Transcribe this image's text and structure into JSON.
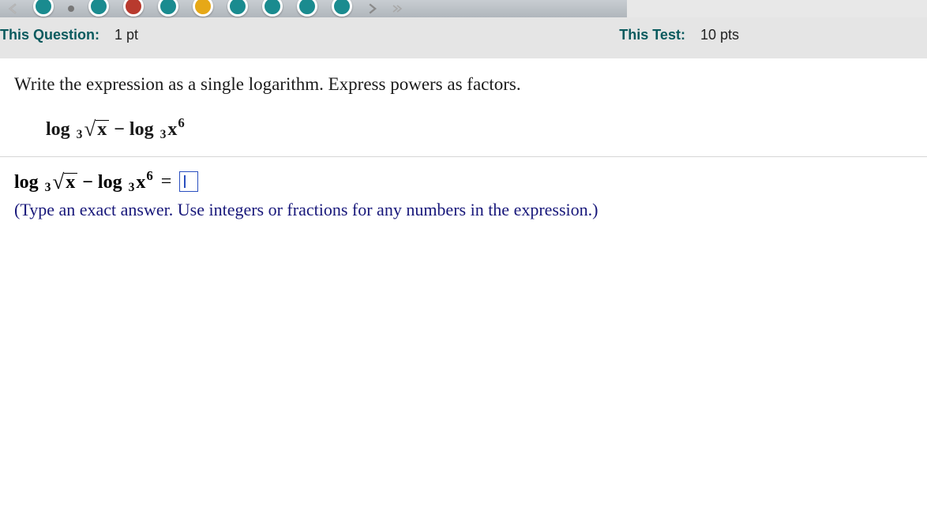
{
  "info": {
    "question_label": "This Question:",
    "question_value": "1 pt",
    "test_label": "This Test:",
    "test_value": "10 pts"
  },
  "problem": {
    "prompt": "Write the expression as a single logarithm.  Express powers as factors.",
    "expression_plain": "log_3 √x − log_3 x^6",
    "log_fn": "log",
    "base": "3",
    "radicand": "x",
    "minus": " − ",
    "power_base": "x",
    "power_exp": "6"
  },
  "answer": {
    "expression_plain": "log_3 √x − log_3 x^6 =",
    "equals": "=",
    "hint": "(Type an exact answer. Use integers or fractions for any numbers in the expression.)"
  }
}
